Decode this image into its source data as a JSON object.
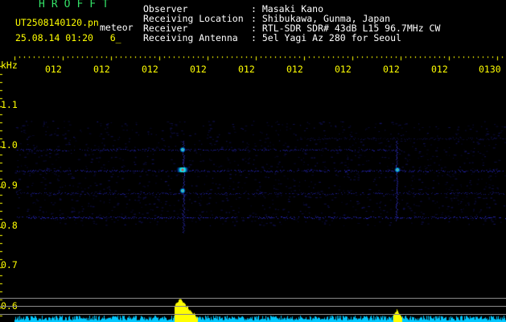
{
  "header": {
    "brand": "HROFFT",
    "filename": "UT2508140120.pn",
    "tag": "meteor",
    "datetime": "25.08.14 01:20   6_",
    "info": [
      {
        "key": "Observer",
        "value": ": Masaki Kano"
      },
      {
        "key": "Receiving Location",
        "value": ": Shibukawa, Gunma, Japan"
      },
      {
        "key": "Receiver",
        "value": ": RTL-SDR SDR# 43dB L15 96.7MHz CW"
      },
      {
        "key": "Receiving Antenna",
        "value": ": 5el Yagi Az 280 for Seoul"
      }
    ]
  },
  "axis": {
    "y_unit": "kHz",
    "y_ticks": [
      "1.1",
      "1.0",
      "0.9",
      "0.8",
      "0.7",
      "0.6"
    ],
    "x_ticks": [
      "012",
      "012",
      "012",
      "012",
      "012",
      "012",
      "012",
      "012",
      "012",
      "0130"
    ]
  },
  "colors": {
    "header_brand": "#33e066",
    "header_text": "#ffff00",
    "info_text": "#ffffff",
    "trace": "#2a2aff",
    "echo_core": "#ff2020",
    "echo_mid": "#00ffff",
    "histogram": "#ffff00",
    "baseline": "#00c8ff"
  }
}
